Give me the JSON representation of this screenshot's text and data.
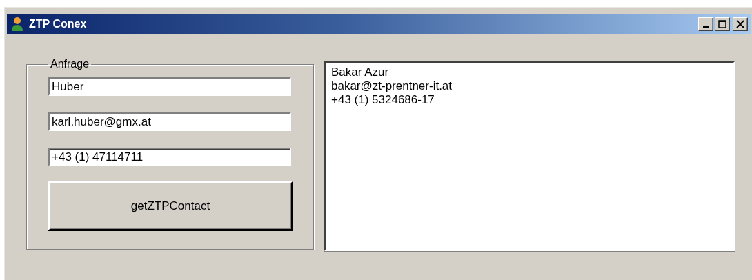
{
  "window": {
    "title": "ZTP Conex"
  },
  "query": {
    "legend": "Anfrage",
    "fields": [
      {
        "value": "Huber"
      },
      {
        "value": "karl.huber@gmx.at"
      },
      {
        "value": "+43 (1) 47114711"
      }
    ],
    "button": "getZTPContact"
  },
  "result": {
    "lines": [
      "Bakar Azur",
      "bakar@zt-prentner-it.at",
      "+43 (1) 5324686-17"
    ]
  }
}
